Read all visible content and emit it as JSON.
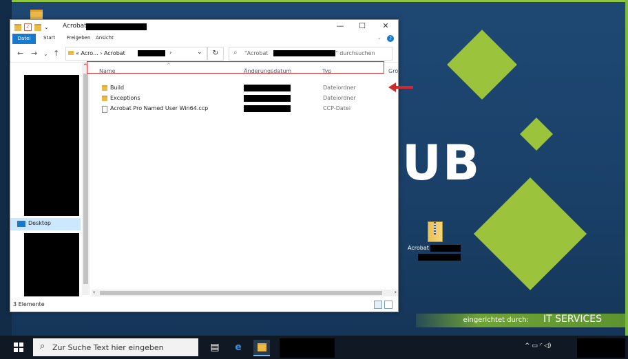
{
  "window": {
    "title": "Acrobat",
    "ribbon_tabs": [
      "Datei",
      "Start",
      "Freigeben",
      "Ansicht"
    ],
    "minimize": "—",
    "maximize": "☐",
    "close": "✕",
    "help": "?"
  },
  "addressbar": {
    "back": "←",
    "forward": "→",
    "recent": "⌄",
    "up": "↑",
    "path": "« Acro... › Acrobat",
    "path_chevron": "›",
    "dropdown": "⌄",
    "refresh": "↻",
    "search_prefix": "\"Acrobat",
    "search_suffix": "\" durchsuchen"
  },
  "navpane": {
    "desktop_label": "Desktop"
  },
  "columns": {
    "name": "Name",
    "date": "Änderungsdatum",
    "type": "Typ",
    "size": "Grö"
  },
  "files": [
    {
      "name": "Build",
      "type": "Dateiordner",
      "kind": "folder"
    },
    {
      "name": "Exceptions",
      "type": "Dateiordner",
      "kind": "folder"
    },
    {
      "name": "Acrobat Pro Named User Win64.ccp",
      "type": "CCP-Datei",
      "kind": "file"
    }
  ],
  "status": {
    "item_count": "3 Elemente"
  },
  "desktop": {
    "brand_text": "UB",
    "zip_label": "Acrobat",
    "banner_text": "eingerichtet durch:",
    "banner_logo": "IT SERVICES"
  },
  "taskbar": {
    "search_placeholder": "Zur Suche Text hier eingeben",
    "tray_text": "^ ▭ ◜ ◁)"
  },
  "colors": {
    "accent_green": "#9bc43c",
    "explorer_blue": "#1979ca",
    "highlight_red": "#e03131"
  }
}
